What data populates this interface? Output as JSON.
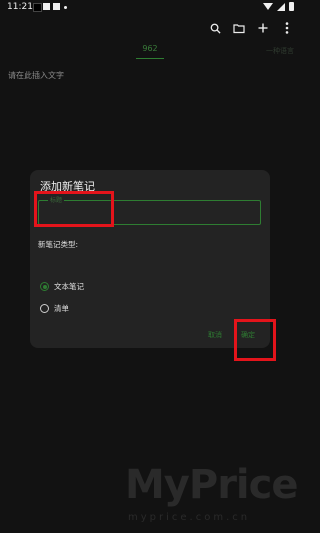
{
  "status_bar": {
    "time": "11:21"
  },
  "toolbar": {
    "icons": [
      "search-icon",
      "folder-icon",
      "add-icon",
      "more-vert-icon"
    ]
  },
  "tabs": {
    "active_label": "962",
    "right_label": "一种语言"
  },
  "editor": {
    "placeholder": "请在此插入文字"
  },
  "dialog": {
    "title": "添加新笔记",
    "title_field_label": "标题",
    "note_type_label": "新笔记类型:",
    "options": [
      {
        "label": "文本笔记",
        "selected": true
      },
      {
        "label": "清单",
        "selected": false
      }
    ],
    "cancel_label": "取消",
    "confirm_label": "确定"
  },
  "colors": {
    "accent": "#2e7d32",
    "highlight": "#e4141b",
    "background": "#121212",
    "dialog": "#232323"
  },
  "watermark": {
    "main": "MyPrice",
    "sub": "myprice.com.cn"
  }
}
